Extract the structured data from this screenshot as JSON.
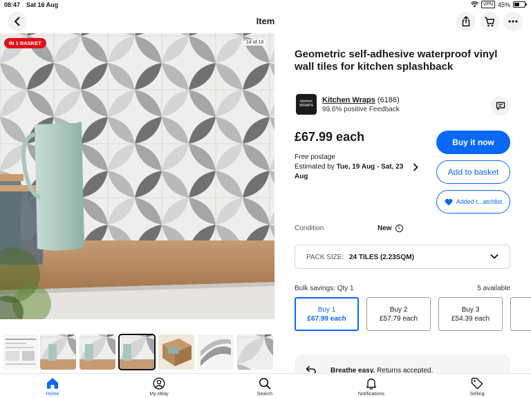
{
  "status_bar": {
    "time": "08:47",
    "date": "Sat 16 Aug",
    "vpn": "VPN",
    "battery": "45%",
    "battery_level": 0.45
  },
  "header": {
    "title": "Item",
    "back_icon": "chevron-left-icon",
    "share_icon": "share-icon",
    "cart_icon": "cart-icon",
    "more_icon": "more-icon"
  },
  "gallery": {
    "badge": "IN 1 BASKET",
    "counter": "14 of 18",
    "thumbnail_count": 7,
    "selected_thumbnail": 4
  },
  "item": {
    "title": "Geometric self-adhesive waterproof vinyl wall tiles for kitchen splashback"
  },
  "seller": {
    "logo_text_1": "kitchen",
    "logo_text_2": "WRAPS",
    "name": "Kitchen Wraps",
    "count": "(6186)",
    "feedback": "99.6% positive Feedback",
    "message_icon": "message-icon"
  },
  "pricing": {
    "price": "£67.99 each",
    "postage": "Free postage",
    "estimated_prefix": "Estimated by ",
    "estimated_dates": "Tue, 19 Aug - Sat, 23 Aug"
  },
  "actions": {
    "buy_now": "Buy it now",
    "add_to_basket": "Add to basket",
    "watchlist": "Added t...atchlist"
  },
  "condition": {
    "label": "Condition",
    "value": "New"
  },
  "pack": {
    "label": "PACK SIZE:",
    "value": "24 TILES (2.23SQM)"
  },
  "bulk": {
    "label": "Bulk savings: Qty 1",
    "available": "5 available",
    "tiers": [
      {
        "label": "Buy 1",
        "price": "£67.99 each"
      },
      {
        "label": "Buy 2",
        "price": "£57.79 each"
      },
      {
        "label": "Buy 3",
        "price": "£54.39 each"
      }
    ]
  },
  "returns": {
    "bold": "Breathe easy.",
    "text": " Returns accepted."
  },
  "tabs": [
    {
      "label": "Home",
      "icon": "home-icon"
    },
    {
      "label": "My eBay",
      "icon": "account-icon"
    },
    {
      "label": "Search",
      "icon": "search-icon"
    },
    {
      "label": "Notifications",
      "icon": "bell-icon"
    },
    {
      "label": "Selling",
      "icon": "tag-icon"
    }
  ],
  "colors": {
    "accent": "#0968f6",
    "badge": "#e0101a"
  }
}
